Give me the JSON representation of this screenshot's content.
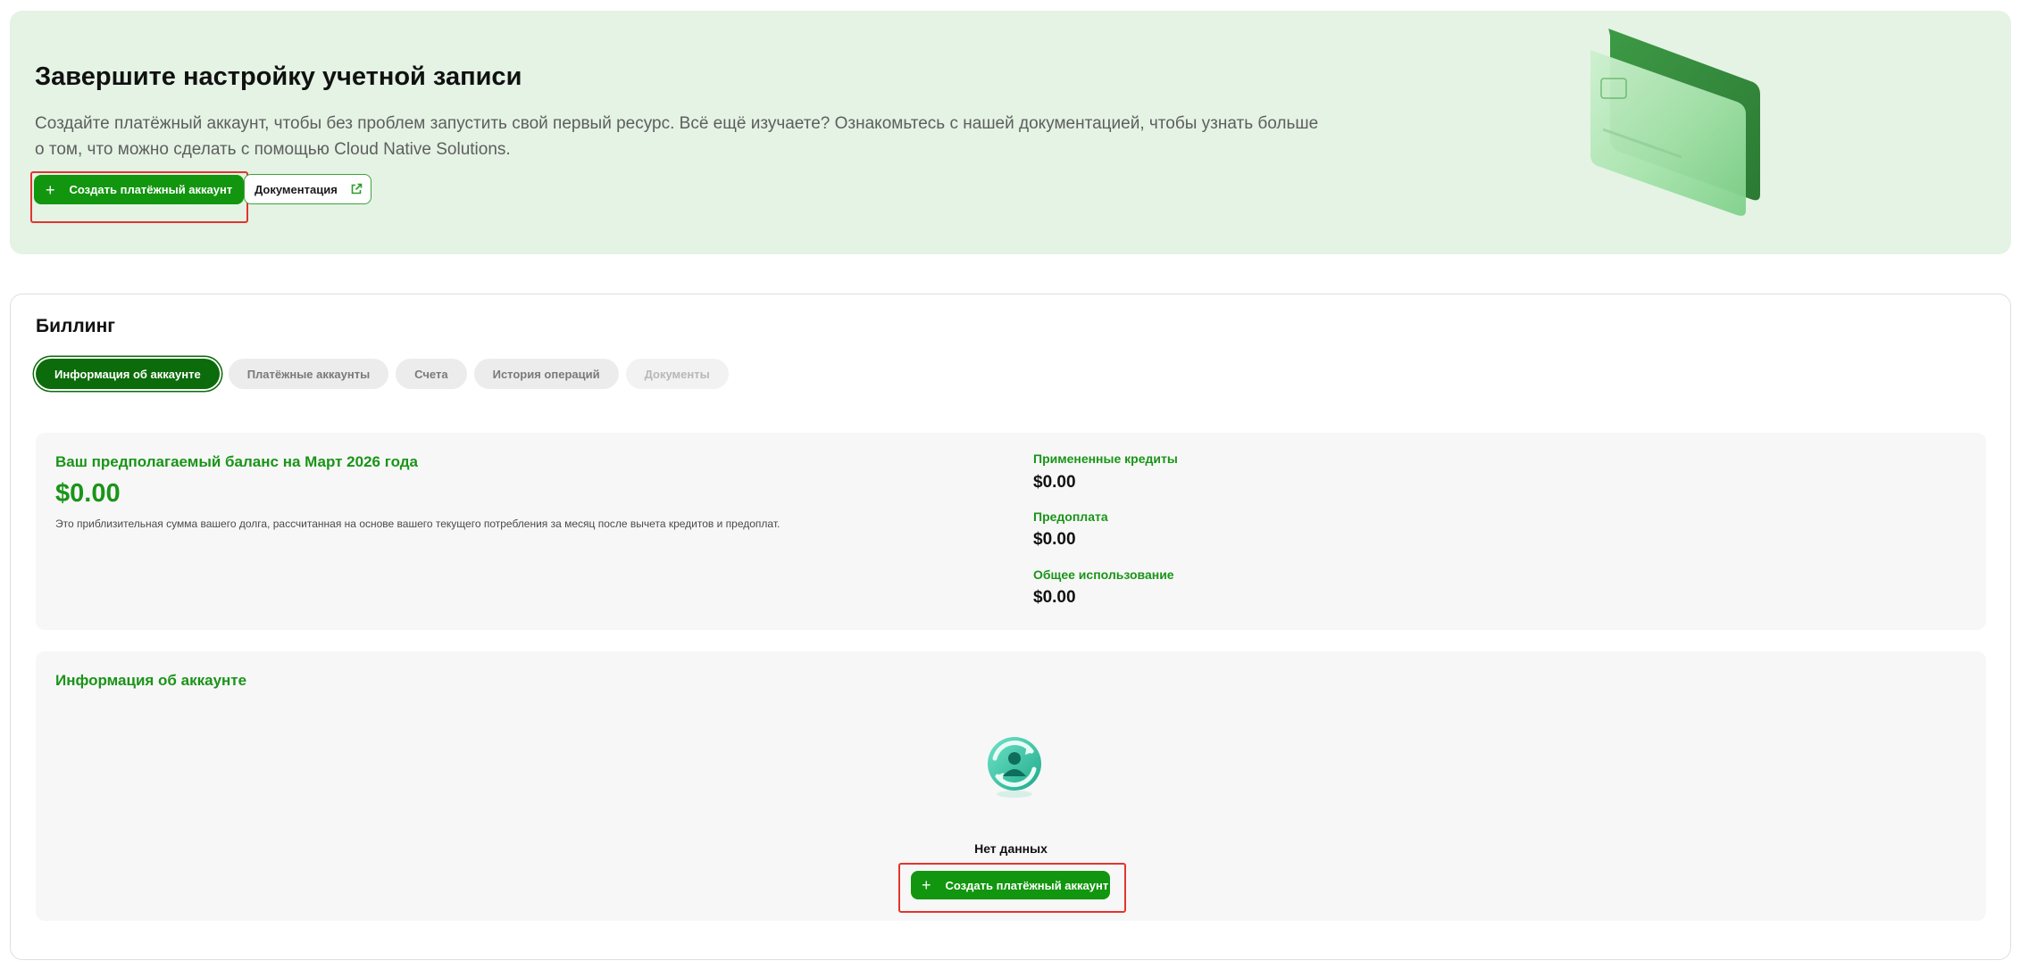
{
  "banner": {
    "title": "Завершите настройку учетной записи",
    "description": "Создайте платёжный аккаунт, чтобы без проблем запустить свой первый ресурс. Всё ещё изучаете? Ознакомьтесь с нашей документацией, чтобы узнать больше о том, что можно сделать с помощью Cloud Native Solutions.",
    "create_button_label": "Создать платёжный аккаунт",
    "docs_button_label": "Документация"
  },
  "billing": {
    "title": "Биллинг",
    "tabs": [
      {
        "label": "Информация об аккаунте",
        "state": "active"
      },
      {
        "label": "Платёжные аккаунты",
        "state": "normal"
      },
      {
        "label": "Счета",
        "state": "normal"
      },
      {
        "label": "История операций",
        "state": "normal"
      },
      {
        "label": "Документы",
        "state": "disabled"
      }
    ],
    "balance": {
      "heading": "Ваш предполагаемый баланс на Март 2026 года",
      "amount": "$0.00",
      "note": "Это приблизительная сумма вашего долга, рассчитанная на основе вашего текущего потребления за месяц после вычета кредитов и предоплат."
    },
    "stats": [
      {
        "label": "Примененные кредиты",
        "value": "$0.00"
      },
      {
        "label": "Предоплата",
        "value": "$0.00"
      },
      {
        "label": "Общее использование",
        "value": "$0.00"
      }
    ],
    "account_info": {
      "heading": "Информация об аккаунте",
      "empty_text": "Нет данных",
      "create_button_label": "Создать платёжный аккаунт"
    }
  },
  "colors": {
    "brand_green": "#12960f",
    "active_tab": "#0c6b0a",
    "banner_bg": "#e4f3e4",
    "highlight_red": "#e3342f"
  },
  "icons": [
    "plus-icon",
    "external-link-icon",
    "credit-card-illustration",
    "user-sync-icon"
  ]
}
